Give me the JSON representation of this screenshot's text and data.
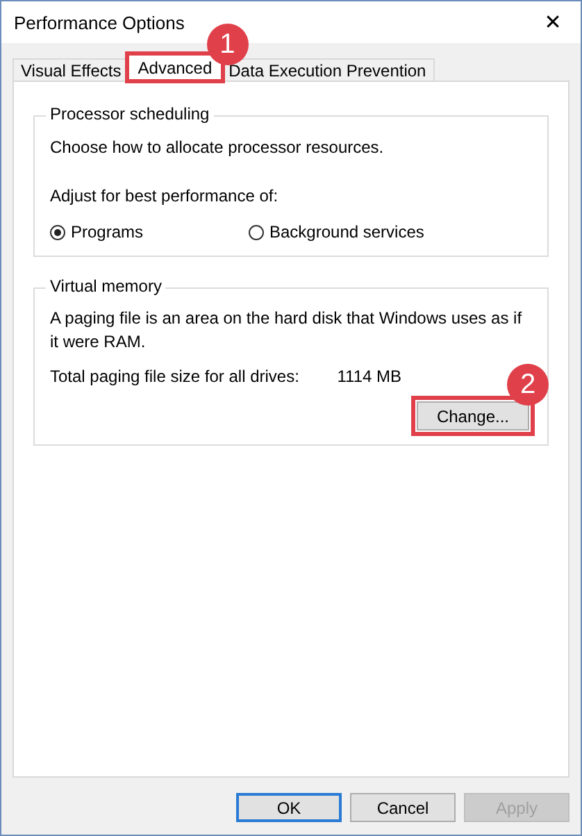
{
  "window": {
    "title": "Performance Options",
    "close": "✕"
  },
  "tabs": [
    {
      "label": "Visual Effects",
      "selected": false
    },
    {
      "label": "Advanced",
      "selected": true,
      "callout": "1"
    },
    {
      "label": "Data Execution Prevention",
      "selected": false
    }
  ],
  "processor_scheduling": {
    "title": "Processor scheduling",
    "description": "Choose how to allocate processor resources.",
    "prompt": "Adjust for best performance of:",
    "options": [
      {
        "label": "Programs",
        "selected": true
      },
      {
        "label": "Background services",
        "selected": false
      }
    ]
  },
  "virtual_memory": {
    "title": "Virtual memory",
    "description": "A paging file is an area on the hard disk that Windows uses as if it were RAM.",
    "total_label": "Total paging file size for all drives:",
    "total_value": "1114 MB",
    "change_button": {
      "label": "Change...",
      "callout": "2"
    }
  },
  "buttons": [
    {
      "label": "OK",
      "default": true,
      "disabled": false
    },
    {
      "label": "Cancel",
      "default": false,
      "disabled": false
    },
    {
      "label": "Apply",
      "default": false,
      "disabled": true
    }
  ]
}
